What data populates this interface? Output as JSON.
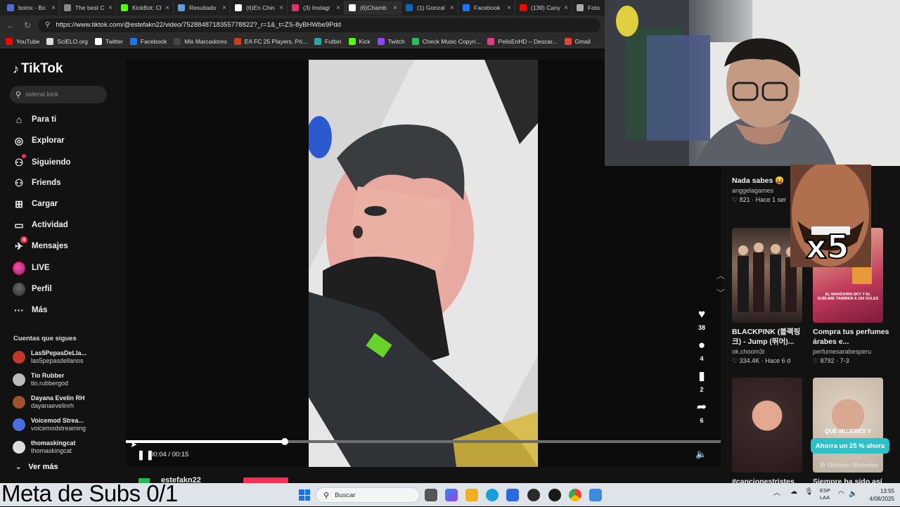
{
  "browser": {
    "tabs": [
      {
        "label": "botrix - Bo",
        "color": "#4a6fd1"
      },
      {
        "label": "The best C",
        "color": "#888888"
      },
      {
        "label": "KickBot: Cl",
        "color": "#53fc18"
      },
      {
        "label": "Resultado",
        "color": "#5aa0e0"
      },
      {
        "label": "(6)En Chin",
        "color": "#ffffff"
      },
      {
        "label": "(3) Instagr",
        "color": "#e1306c"
      },
      {
        "label": "(6)Chamb",
        "color": "#ffffff"
      },
      {
        "label": "(1) Gonzal",
        "color": "#0a66c2"
      },
      {
        "label": "Facebook",
        "color": "#1877f2"
      },
      {
        "label": "(139) Cany",
        "color": "#ff0000"
      },
      {
        "label": "Foto",
        "color": "#aaaaaa"
      }
    ],
    "url": "https://www.tiktok.com/@estefakn22/video/7528848718355778822?_r=1&_t=ZS-8yBHWbe9Pdd",
    "bookmarks": [
      {
        "label": "YouTube",
        "color": "#ff0000"
      },
      {
        "label": "SciELO.org",
        "color": "#dddddd"
      },
      {
        "label": "Twitter",
        "color": "#ffffff"
      },
      {
        "label": "Facebook",
        "color": "#1877f2"
      },
      {
        "label": "Mis Marcadores",
        "color": "#444444"
      },
      {
        "label": "EA FC 25 Players, Pri...",
        "color": "#d13a1a"
      },
      {
        "label": "Futbin",
        "color": "#28a8a0"
      },
      {
        "label": "Kick",
        "color": "#53fc18"
      },
      {
        "label": "Twitch",
        "color": "#9146ff"
      },
      {
        "label": "Check Music Copyri...",
        "color": "#2bbd5a"
      },
      {
        "label": "PelisEnHD – Descar...",
        "color": "#e33a8a"
      },
      {
        "label": "Gmail",
        "color": "#ea4335"
      }
    ]
  },
  "sidebar": {
    "logo": "TikTok",
    "search_placeholder": "sideral kick",
    "nav": [
      {
        "label": "Para ti",
        "icon": "home-icon"
      },
      {
        "label": "Explorar",
        "icon": "compass-icon"
      },
      {
        "label": "Siguiendo",
        "icon": "following-icon"
      },
      {
        "label": "Friends",
        "icon": "friends-icon"
      },
      {
        "label": "Cargar",
        "icon": "upload-icon"
      },
      {
        "label": "Actividad",
        "icon": "activity-icon"
      },
      {
        "label": "Mensajes",
        "icon": "messages-icon",
        "badge": "4"
      },
      {
        "label": "LIVE",
        "icon": "live-icon"
      },
      {
        "label": "Perfil",
        "icon": "profile-icon"
      },
      {
        "label": "Más",
        "icon": "more-icon"
      }
    ],
    "following_header": "Cuentas que sigues",
    "following": [
      {
        "name": "Las5PepasDeLla...",
        "handle": "las5pepasdellanos",
        "color": "#c0392b"
      },
      {
        "name": "Tio Rubber",
        "handle": "tio.rubbergod",
        "color": "#bbbbbb"
      },
      {
        "name": "Dayana Evelin RH",
        "handle": "dayanaevelinrh",
        "color": "#a0522d"
      },
      {
        "name": "Voicemod Strea...",
        "handle": "voicemodstreaming",
        "color": "#4a6fe0"
      },
      {
        "name": "thomaskingcat",
        "handle": "thomaskingcat",
        "color": "#dddddd"
      }
    ],
    "ver_mas": "Ver más"
  },
  "player": {
    "progress": 0.267,
    "time": "00:04 / 00:15",
    "author": "estefakn22",
    "actions": {
      "likes": "38",
      "comments": "4",
      "saves": "2",
      "shares": "6"
    }
  },
  "recommendations": [
    {
      "title": "Nada sabes 😝",
      "author": "anggelagames",
      "stats": "♡ 821 · Hace 1 ser",
      "thumb": "#4b4b4b"
    },
    {
      "title": "BLACKPINK (블랙핑크) - Jump (뛰어)...",
      "author": "ok.choom3r",
      "stats": "♡ 334.4K · Hace 6 d",
      "thumb": "#7a6a5a"
    },
    {
      "title": "Compra tus perfumes árabes e...",
      "author": "perfumesarabesperu",
      "stats": "♡ 8792 · 7-3",
      "thumb": "#c23a5a",
      "overlay": "EL MANDARIN SKY Y EL SUBLIME TAMBIEN A 150 SOLES"
    },
    {
      "title": "#cancionestristes",
      "author": "",
      "stats": "",
      "thumb": "#3a2a2a"
    },
    {
      "title": "Siempre ha sido así",
      "author": "",
      "stats": "",
      "thumb": "#c9b8a8",
      "overlay": "QUE MUJERES Y"
    }
  ],
  "promo": {
    "coins_button": "Ahorra un 25 % ahora",
    "coins_label": "Obtener Monedas"
  },
  "overlay": {
    "caption": "Meta de Subs 0/1",
    "meme_text": "x5"
  },
  "taskbar": {
    "search": "Buscar",
    "lang": [
      "ESP",
      "LAA"
    ],
    "time": "13:55",
    "date": "4/08/2025"
  }
}
